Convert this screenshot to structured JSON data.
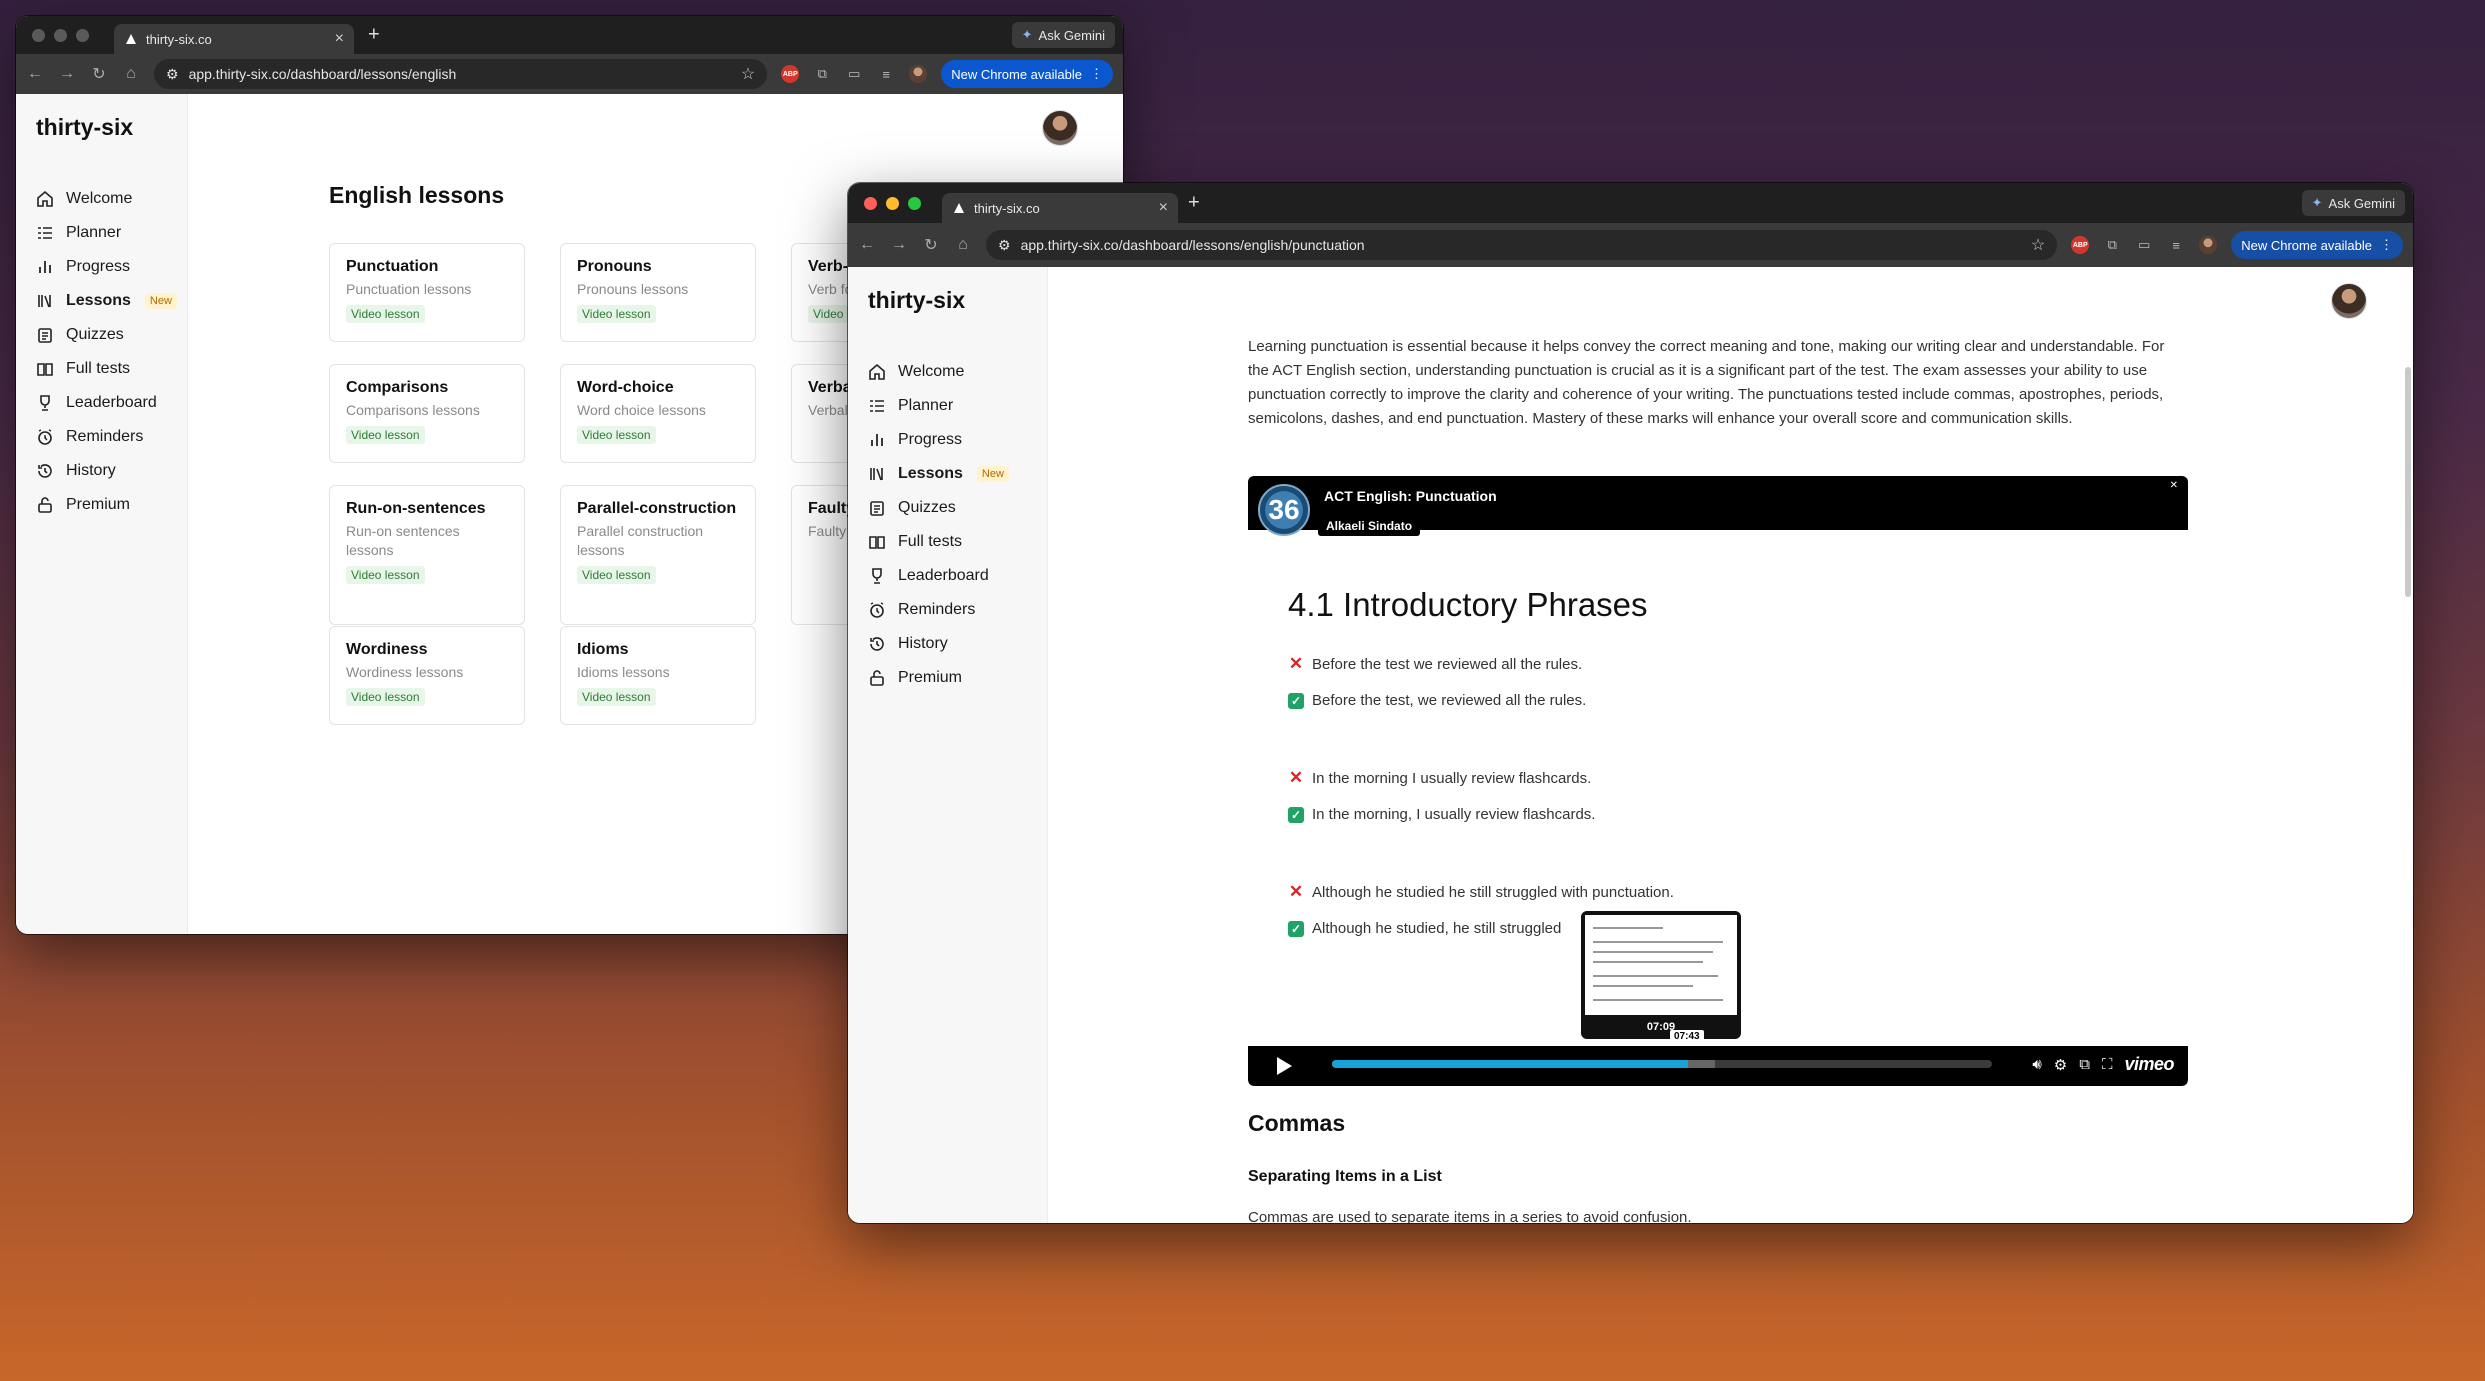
{
  "back_window": {
    "tab_title": "thirty-six.co",
    "ask_gemini": "Ask Gemini",
    "url": "app.thirty-six.co/dashboard/lessons/english",
    "chrome_update": "New Chrome available",
    "brand": "thirty-six",
    "nav": [
      {
        "label": "Welcome"
      },
      {
        "label": "Planner"
      },
      {
        "label": "Progress"
      },
      {
        "label": "Lessons",
        "badge": "New"
      },
      {
        "label": "Quizzes"
      },
      {
        "label": "Full tests"
      },
      {
        "label": "Leaderboard"
      },
      {
        "label": "Reminders"
      },
      {
        "label": "History"
      },
      {
        "label": "Premium"
      }
    ],
    "heading": "English lessons",
    "cards": [
      {
        "title": "Punctuation",
        "subtitle": "Punctuation lessons",
        "badge": "Video lesson"
      },
      {
        "title": "Pronouns",
        "subtitle": "Pronouns lessons",
        "badge": "Video lesson"
      },
      {
        "title": "Verb-",
        "subtitle": "Verb fo",
        "badge": "Video"
      },
      {
        "title": "Comparisons",
        "subtitle": "Comparisons lessons",
        "badge": "Video lesson"
      },
      {
        "title": "Word-choice",
        "subtitle": "Word choice lessons",
        "badge": "Video lesson"
      },
      {
        "title": "Verba",
        "subtitle": "Verbal",
        "badge": ""
      },
      {
        "title": "Run-on-sentences",
        "subtitle": "Run-on sentences lessons",
        "badge": "Video lesson"
      },
      {
        "title": "Parallel-construction",
        "subtitle": "Parallel construction lessons",
        "badge": "Video lesson"
      },
      {
        "title": "Faulty",
        "subtitle": "Faulty",
        "badge": ""
      },
      {
        "title": "Wordiness",
        "subtitle": "Wordiness lessons",
        "badge": "Video lesson"
      },
      {
        "title": "Idioms",
        "subtitle": "Idioms lessons",
        "badge": "Video lesson"
      }
    ]
  },
  "front_window": {
    "tab_title": "thirty-six.co",
    "ask_gemini": "Ask Gemini",
    "url": "app.thirty-six.co/dashboard/lessons/english/punctuation",
    "chrome_update": "New Chrome available",
    "brand": "thirty-six",
    "nav": [
      {
        "label": "Welcome"
      },
      {
        "label": "Planner"
      },
      {
        "label": "Progress"
      },
      {
        "label": "Lessons",
        "badge": "New"
      },
      {
        "label": "Quizzes"
      },
      {
        "label": "Full tests"
      },
      {
        "label": "Leaderboard"
      },
      {
        "label": "Reminders"
      },
      {
        "label": "History"
      },
      {
        "label": "Premium"
      }
    ],
    "intro_text": "Learning punctuation is essential because it helps convey the correct meaning and tone, making our writing clear and understandable. For the ACT English section, understanding punctuation is crucial as it is a significant part of the test. The exam assesses your ability to use punctuation correctly to improve the clarity and coherence of your writing. The punctuations tested include commas, apostrophes, periods, semicolons, dashes, and end punctuation. Mastery of these marks will enhance your overall score and communication skills.",
    "video": {
      "logo_text": "36",
      "title": "ACT English: Punctuation",
      "author": "Alkaeli Sindato",
      "slide_heading": "4.1 Introductory Phrases",
      "rows": [
        {
          "mark": "wrong",
          "text": "Before the test we reviewed all the rules."
        },
        {
          "mark": "right",
          "text": "Before the test, we reviewed all the rules."
        },
        {
          "mark": "wrong",
          "text": "In the morning I usually review flashcards."
        },
        {
          "mark": "right",
          "text": "In the morning, I usually review flashcards."
        },
        {
          "mark": "wrong",
          "text": "Although he studied he still struggled with punctuation."
        },
        {
          "mark": "right",
          "text": "Although he studied, he still struggled"
        }
      ],
      "preview_time": "07:09",
      "hover_time": "07:43",
      "progress_fraction": 0.54,
      "buffered_fraction": 0.58,
      "brand": "vimeo"
    },
    "section_heading": "Commas",
    "sub_heading": "Separating Items in a List",
    "cut_text": "Commas are used to separate items in a series to avoid confusion."
  }
}
